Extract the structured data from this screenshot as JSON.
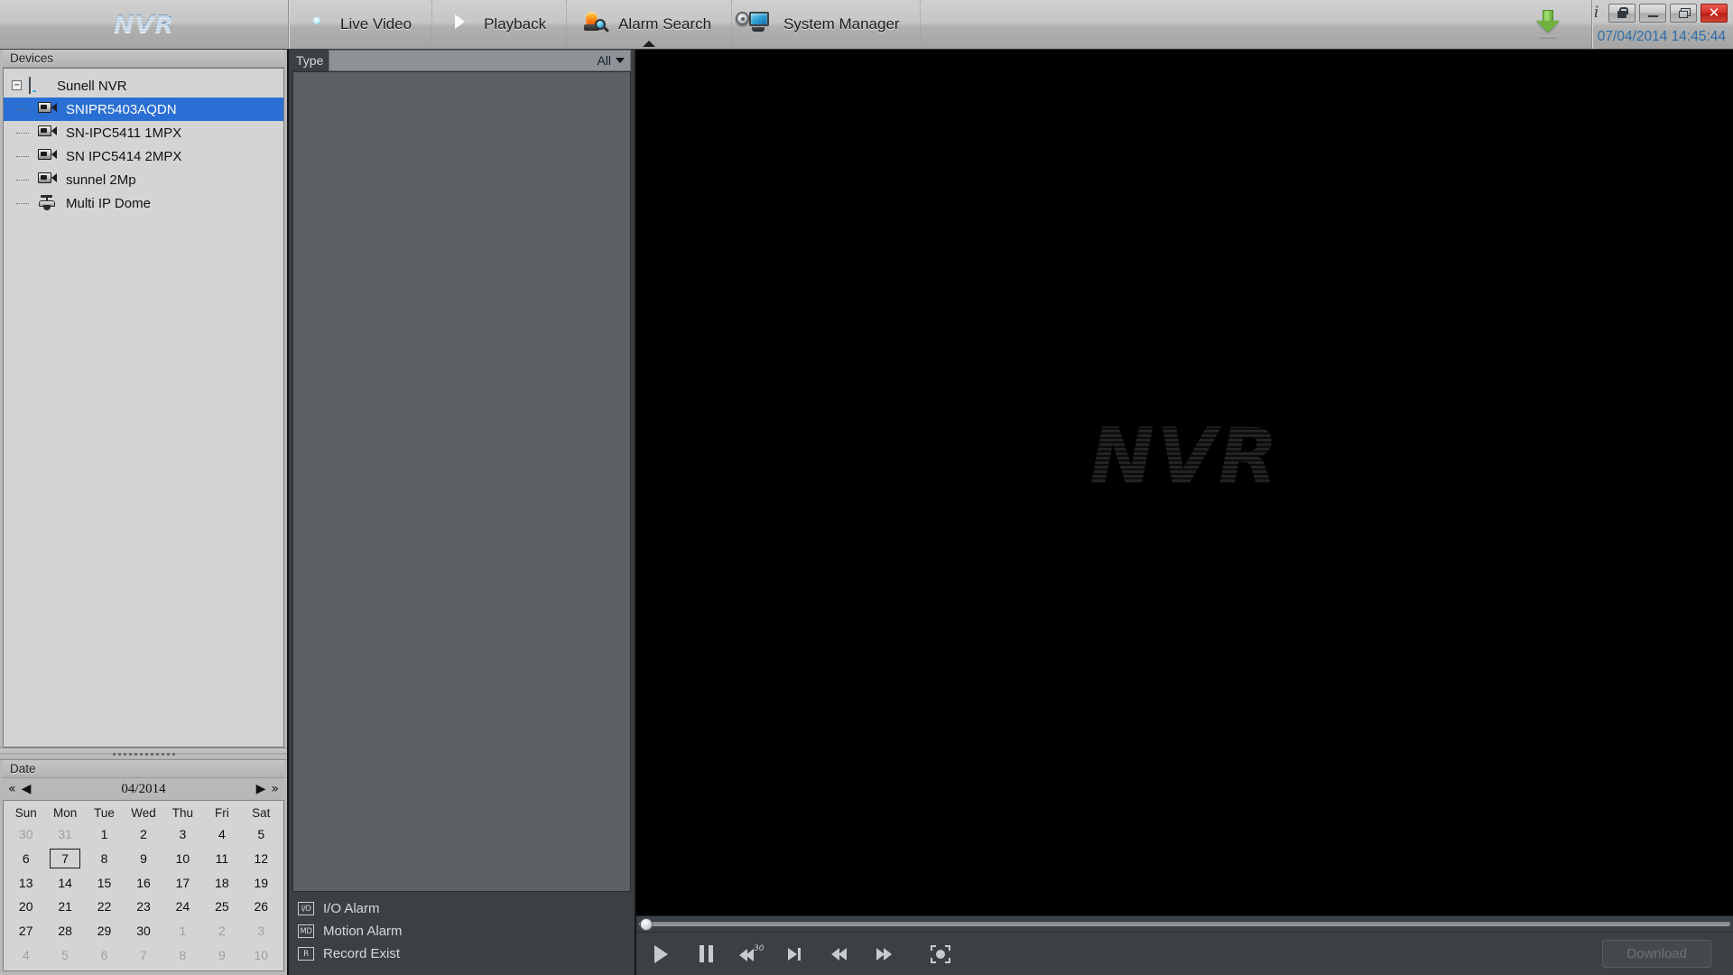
{
  "app": {
    "brand": "NVR",
    "timestamp": "07/04/2014 14:45:44"
  },
  "nav": {
    "tabs": [
      {
        "label": "Live Video",
        "icon": "eye-icon",
        "active": false
      },
      {
        "label": "Playback",
        "icon": "reel-icon",
        "active": false
      },
      {
        "label": "Alarm Search",
        "icon": "alarm-icon",
        "active": true
      },
      {
        "label": "System Manager",
        "icon": "monitor-icon",
        "active": false
      }
    ]
  },
  "window_controls": {
    "info": "i",
    "lock_title": "Lock",
    "minimize_title": "Minimize",
    "restore_title": "Restore",
    "close_label": "✕",
    "download_icon": "download-arrow-icon"
  },
  "devices": {
    "caption": "Devices",
    "root": {
      "label": "Sunell NVR",
      "icon": "nvr-device-icon",
      "expanded": true,
      "toggle_glyph": "−"
    },
    "children": [
      {
        "label": "SNIPR5403AQDN",
        "icon": "camera-icon",
        "selected": true
      },
      {
        "label": "SN-IPC5411 1MPX",
        "icon": "camera-icon",
        "selected": false
      },
      {
        "label": "SN IPC5414 2MPX",
        "icon": "camera-icon",
        "selected": false
      },
      {
        "label": "sunnel 2Mp",
        "icon": "camera-icon",
        "selected": false
      },
      {
        "label": "Multi IP Dome",
        "icon": "dome-camera-icon",
        "selected": false
      }
    ]
  },
  "calendar": {
    "caption": "Date",
    "month_label": "04/2014",
    "nav": {
      "prev_year": "«",
      "prev_month": "◀",
      "next_month": "▶",
      "next_year": "»"
    },
    "day_headers": [
      "Sun",
      "Mon",
      "Tue",
      "Wed",
      "Thu",
      "Fri",
      "Sat"
    ],
    "selected_day": 7,
    "weeks": [
      [
        {
          "d": "30",
          "other": true
        },
        {
          "d": "31",
          "other": true
        },
        {
          "d": "1",
          "other": false
        },
        {
          "d": "2",
          "other": false
        },
        {
          "d": "3",
          "other": false
        },
        {
          "d": "4",
          "other": false
        },
        {
          "d": "5",
          "other": false
        }
      ],
      [
        {
          "d": "6",
          "other": false
        },
        {
          "d": "7",
          "other": false,
          "sel": true
        },
        {
          "d": "8",
          "other": false
        },
        {
          "d": "9",
          "other": false
        },
        {
          "d": "10",
          "other": false
        },
        {
          "d": "11",
          "other": false
        },
        {
          "d": "12",
          "other": false
        }
      ],
      [
        {
          "d": "13",
          "other": false
        },
        {
          "d": "14",
          "other": false
        },
        {
          "d": "15",
          "other": false
        },
        {
          "d": "16",
          "other": false
        },
        {
          "d": "17",
          "other": false
        },
        {
          "d": "18",
          "other": false
        },
        {
          "d": "19",
          "other": false
        }
      ],
      [
        {
          "d": "20",
          "other": false
        },
        {
          "d": "21",
          "other": false
        },
        {
          "d": "22",
          "other": false
        },
        {
          "d": "23",
          "other": false
        },
        {
          "d": "24",
          "other": false
        },
        {
          "d": "25",
          "other": false
        },
        {
          "d": "26",
          "other": false
        }
      ],
      [
        {
          "d": "27",
          "other": false
        },
        {
          "d": "28",
          "other": false
        },
        {
          "d": "29",
          "other": false
        },
        {
          "d": "30",
          "other": false
        },
        {
          "d": "1",
          "other": true
        },
        {
          "d": "2",
          "other": true
        },
        {
          "d": "3",
          "other": true
        }
      ],
      [
        {
          "d": "4",
          "other": true
        },
        {
          "d": "5",
          "other": true
        },
        {
          "d": "6",
          "other": true
        },
        {
          "d": "7",
          "other": true
        },
        {
          "d": "8",
          "other": true
        },
        {
          "d": "9",
          "other": true
        },
        {
          "d": "10",
          "other": true
        }
      ]
    ]
  },
  "search_panel": {
    "type_label": "Type",
    "type_value": "All",
    "type_options": [
      "All"
    ],
    "results": [],
    "legend": [
      {
        "badge": "I/O",
        "label": "I/O Alarm"
      },
      {
        "badge": "MD",
        "label": "Motion Alarm"
      },
      {
        "badge": "R",
        "label": "Record Exist"
      }
    ]
  },
  "video": {
    "watermark": "NVR",
    "timeline_position_pct": 0
  },
  "transport": {
    "buttons": [
      {
        "name": "play",
        "icon": "play-icon"
      },
      {
        "name": "pause",
        "icon": "pause-icon"
      },
      {
        "name": "rewind-30",
        "icon": "rewind-30-icon",
        "badge": "30"
      },
      {
        "name": "step-forward",
        "icon": "step-forward-icon"
      },
      {
        "name": "fast-rewind",
        "icon": "fast-rewind-icon"
      },
      {
        "name": "fast-forward",
        "icon": "fast-forward-icon"
      },
      {
        "name": "fullscreen",
        "icon": "fullscreen-icon"
      }
    ],
    "download_label": "Download",
    "download_enabled": false
  },
  "colors": {
    "accent_blue": "#2e6ea8",
    "selection_blue": "#2a6fd4",
    "header_gray": "#c6c6c6",
    "panel_dark": "#3b4045",
    "video_black": "#000000",
    "close_red": "#d43227",
    "download_green": "#6fb23e"
  }
}
